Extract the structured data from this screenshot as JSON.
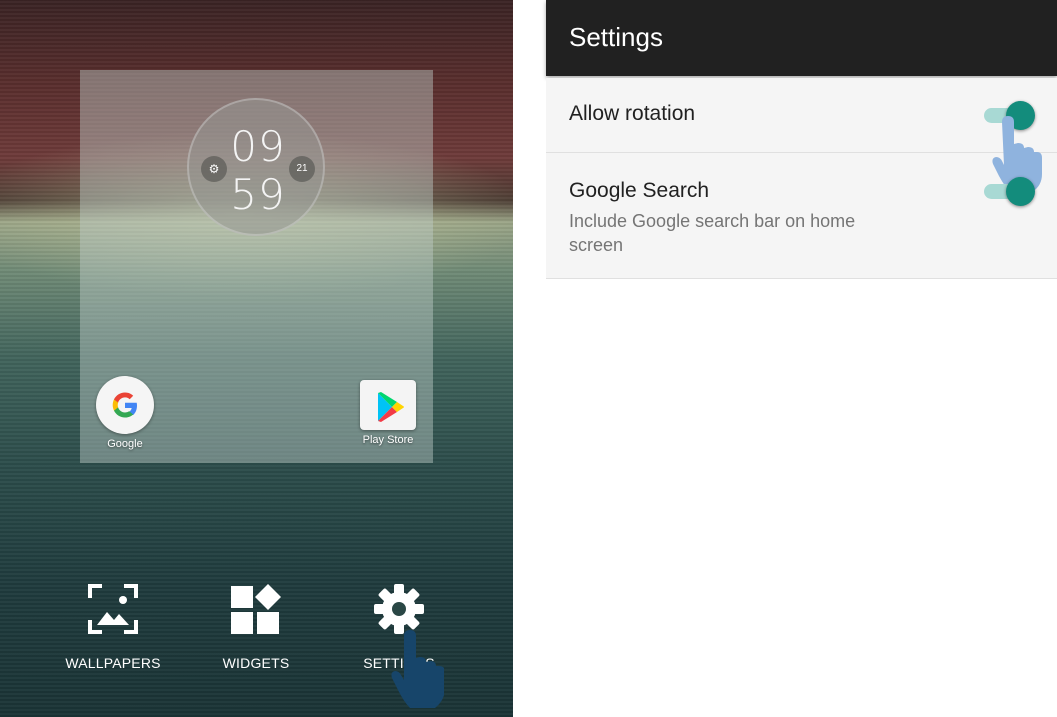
{
  "home": {
    "clock": {
      "hour": "09",
      "minute": "59",
      "date_badge": "21"
    },
    "apps": [
      {
        "label": "Google",
        "icon": "google-g-icon"
      },
      {
        "label": "Play Store",
        "icon": "play-store-icon"
      }
    ],
    "actions": [
      {
        "label": "WALLPAPERS",
        "icon": "wallpaper-icon"
      },
      {
        "label": "WIDGETS",
        "icon": "widgets-icon"
      },
      {
        "label": "SETTINGS",
        "icon": "gear-icon"
      }
    ]
  },
  "settings": {
    "title": "Settings",
    "items": [
      {
        "title": "Allow rotation",
        "summary": "",
        "enabled": true
      },
      {
        "title": "Google Search",
        "summary": "Include Google search bar on home screen",
        "enabled": true
      }
    ]
  },
  "colors": {
    "appbar": "#212121",
    "switch_thumb": "#138c7c",
    "switch_track": "#a8d9d4",
    "hand_pointer_left": "#17456a",
    "hand_pointer_right": "#8fb3de"
  }
}
